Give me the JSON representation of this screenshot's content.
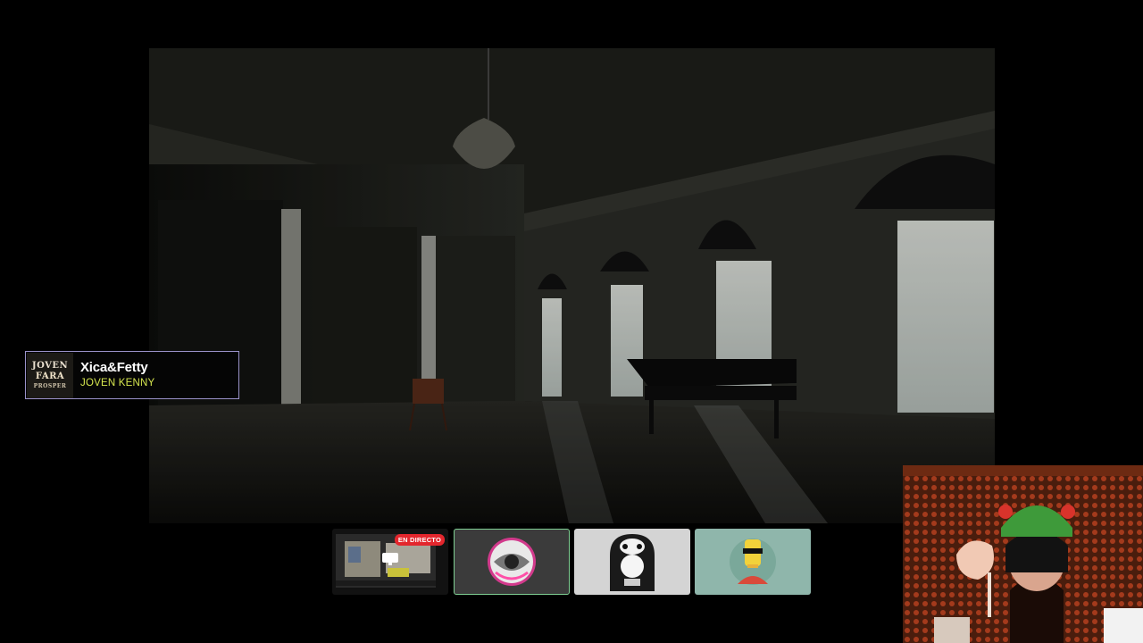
{
  "now_playing": {
    "title": "Xica&Fetty",
    "artist": "JOVEN KENNY",
    "cover_text": [
      "JOVEN",
      "FARA",
      "PROSPER"
    ],
    "border_color": "#9a92c9",
    "artist_color": "#d6e64f"
  },
  "participants": [
    {
      "name": "screen-share",
      "badge": "EN DIRECTO",
      "icon": "screen-share-icon"
    },
    {
      "name": "avatar-sphere",
      "icon": "sphere-avatar-icon",
      "active": true
    },
    {
      "name": "avatar-ghost",
      "icon": "ghost-avatar-icon"
    },
    {
      "name": "avatar-character",
      "icon": "character-avatar-icon"
    }
  ],
  "colors": {
    "live_badge": "#e3262d",
    "active_tile_border": "#7fcf93"
  }
}
